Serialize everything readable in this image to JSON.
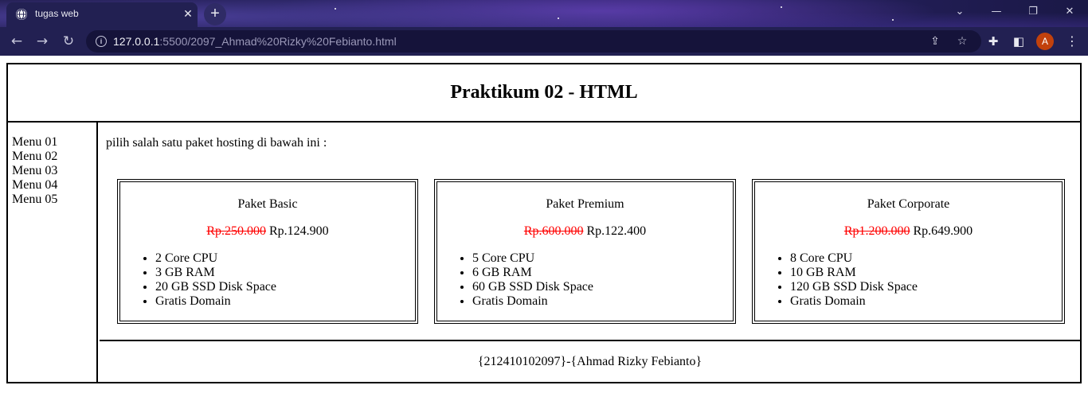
{
  "browser": {
    "tab_title": "tugas web",
    "tab_close": "✕",
    "new_tab": "+",
    "url_host": "127.0.0.1",
    "url_rest": ":5500/2097_Ahmad%20Rizky%20Febianto.html",
    "avatar_letter": "A"
  },
  "page": {
    "title": "Praktikum 02 - HTML",
    "menu": [
      "Menu 01",
      "Menu 02",
      "Menu 03",
      "Menu 04",
      "Menu 05"
    ],
    "intro": "pilih salah satu paket hosting di bawah ini :",
    "packages": [
      {
        "name": "Paket Basic",
        "old_price": "Rp.250.000",
        "price": "Rp.124.900",
        "features": [
          "2 Core CPU",
          "3 GB RAM",
          "20 GB SSD Disk Space",
          "Gratis Domain"
        ]
      },
      {
        "name": "Paket Premium",
        "old_price": "Rp.600.000",
        "price": "Rp.122.400",
        "features": [
          "5 Core CPU",
          "6 GB RAM",
          "60 GB SSD Disk Space",
          "Gratis Domain"
        ]
      },
      {
        "name": "Paket Corporate",
        "old_price": "Rp1.200.000",
        "price": "Rp.649.900",
        "features": [
          "8 Core CPU",
          "10 GB RAM",
          "120 GB SSD Disk Space",
          "Gratis Domain"
        ]
      }
    ],
    "footer": "{212410102097}-{Ahmad Rizky Febianto}"
  },
  "colors": {
    "strike_price": "#ff0000",
    "avatar_bg": "#c2410c"
  }
}
